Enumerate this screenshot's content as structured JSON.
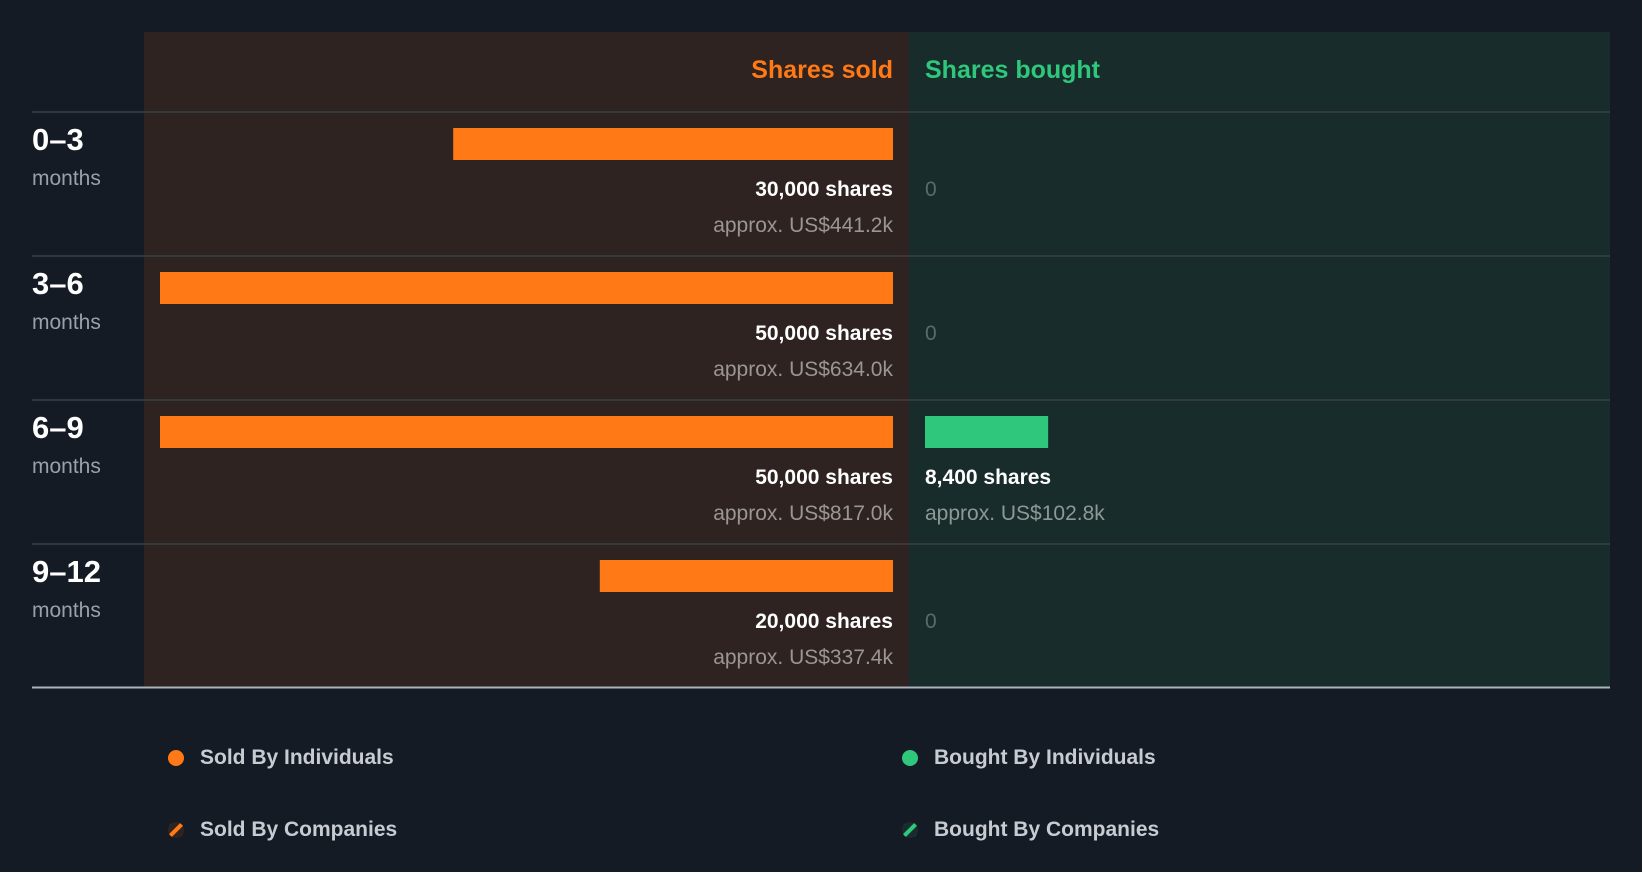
{
  "colors": {
    "background": "#141b24",
    "sold": "#ff7a16",
    "bought": "#2ec77c",
    "sold_panel": "#2e2320",
    "bought_panel": "#182c2b"
  },
  "chart_data": {
    "type": "bar",
    "headers": {
      "sold": "Shares sold",
      "bought": "Shares bought"
    },
    "max_shares": 50000,
    "rows": [
      {
        "label": "0–3",
        "unit": "months",
        "sold": 30000,
        "sold_label": "30,000 shares",
        "sold_value": "approx. US$441.2k",
        "bought": 0,
        "bought_label": "0",
        "bought_value": ""
      },
      {
        "label": "3–6",
        "unit": "months",
        "sold": 50000,
        "sold_label": "50,000 shares",
        "sold_value": "approx. US$634.0k",
        "bought": 0,
        "bought_label": "0",
        "bought_value": ""
      },
      {
        "label": "6–9",
        "unit": "months",
        "sold": 50000,
        "sold_label": "50,000 shares",
        "sold_value": "approx. US$817.0k",
        "bought": 8400,
        "bought_label": "8,400 shares",
        "bought_value": "approx. US$102.8k"
      },
      {
        "label": "9–12",
        "unit": "months",
        "sold": 20000,
        "sold_label": "20,000 shares",
        "sold_value": "approx. US$337.4k",
        "bought": 0,
        "bought_label": "0",
        "bought_value": ""
      }
    ]
  },
  "legend": {
    "sold_individuals": "Sold By Individuals",
    "bought_individuals": "Bought By Individuals",
    "sold_companies": "Sold By Companies",
    "bought_companies": "Bought By Companies"
  }
}
